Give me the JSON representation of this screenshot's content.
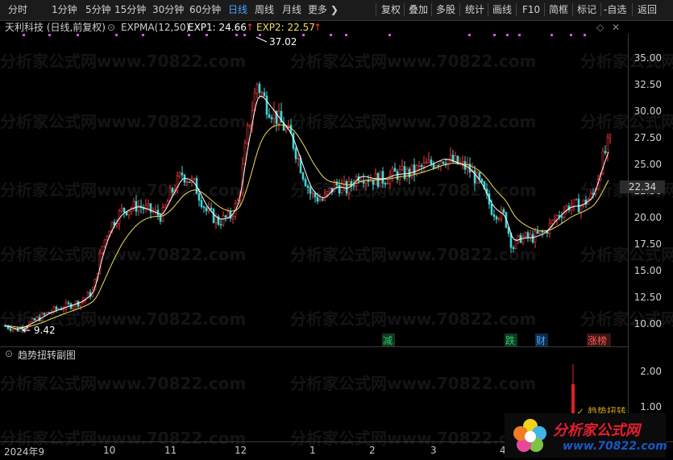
{
  "toolbar": {
    "periods": [
      "分时",
      "1分钟",
      "5分钟",
      "15分钟",
      "30分钟",
      "60分钟",
      "日线",
      "周线",
      "月线",
      "更多 ❯"
    ],
    "active_period": "日线",
    "actions": [
      "复权",
      "叠加",
      "多股",
      "统计",
      "画线",
      "F10",
      "简框",
      "标记",
      "-自选",
      "返回"
    ]
  },
  "indicator": {
    "title": "天利科技 (日线,前复权)",
    "name": "EXPMA(12,50)",
    "exp1_label": "EXP1: 24.66",
    "exp1_arrow": "↑",
    "exp2_label": "EXP2: 22.57",
    "exp2_arrow": "↑",
    "colors": {
      "exp1": "#ffffff",
      "exp2": "#f0e05a",
      "up": "#ff3b3b",
      "down": "#3fd6d6"
    }
  },
  "price_axis": [
    "35.00",
    "32.50",
    "30.00",
    "27.50",
    "25.00",
    "22.50",
    "20.00",
    "17.50",
    "15.00",
    "12.50",
    "10.00"
  ],
  "current_price": "22.34",
  "annotations": {
    "high": "37.02",
    "low": "9.42"
  },
  "event_markers": [
    {
      "text": "减",
      "color": "#2ec76a"
    },
    {
      "text": "跌",
      "color": "#2ec76a"
    },
    {
      "text": "财",
      "color": "#4aa3ff"
    },
    {
      "text": "涨榜",
      "color": "#ff5a5a"
    }
  ],
  "sub_chart": {
    "title": "趋势扭转副图",
    "axis": [
      "2.00",
      "1.00"
    ],
    "annotation": "趋势扭转"
  },
  "time_axis": [
    "2024年9",
    "10",
    "11",
    "12",
    "1",
    "2",
    "3",
    "4"
  ],
  "watermark": {
    "text": "分析家公式网www.70822.com"
  },
  "logo": {
    "name": "分析家公式网",
    "url": "www.70822.com"
  }
}
